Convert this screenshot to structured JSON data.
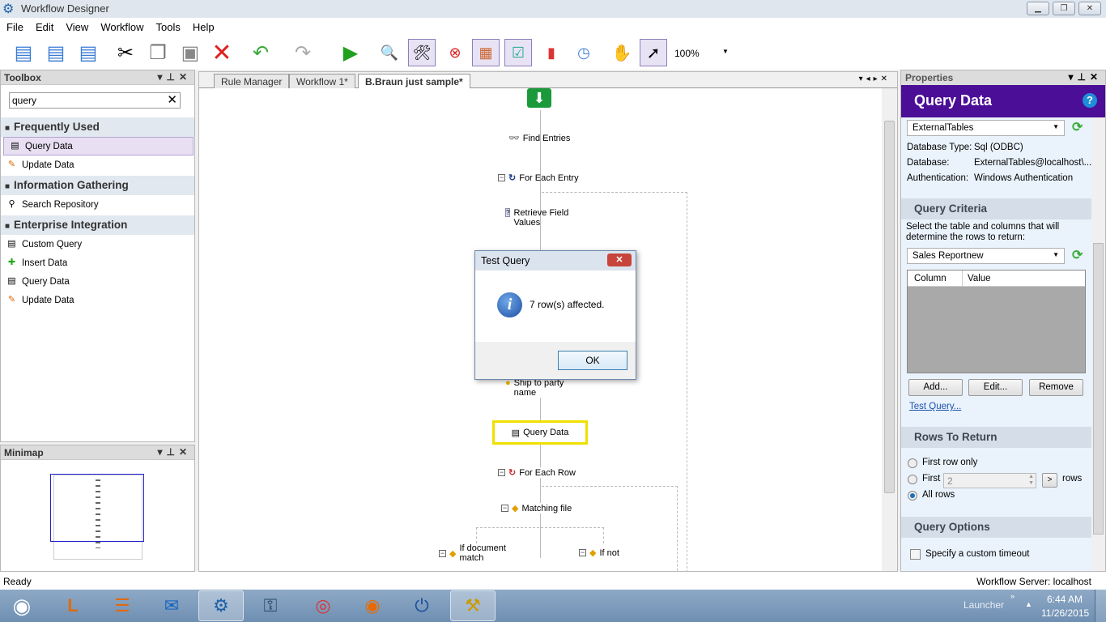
{
  "window": {
    "title": "Workflow Designer",
    "minimize": "▁",
    "restore": "❐",
    "close": "✕"
  },
  "menu": [
    "File",
    "Edit",
    "View",
    "Workflow",
    "Tools",
    "Help"
  ],
  "toolbar": {
    "zoom": "100%"
  },
  "toolbox": {
    "title": "Toolbox",
    "search_value": "query",
    "categories": [
      {
        "label": "Frequently Used",
        "items": [
          "Query Data",
          "Update Data"
        ]
      },
      {
        "label": "Information Gathering",
        "items": [
          "Search Repository"
        ]
      },
      {
        "label": "Enterprise Integration",
        "items": [
          "Custom Query",
          "Insert Data",
          "Query Data",
          "Update Data"
        ]
      }
    ]
  },
  "minimap": {
    "title": "Minimap"
  },
  "tabs": [
    "Rule Manager",
    "Workflow 1*",
    "B.Braun just sample*"
  ],
  "workflow": {
    "nodes": [
      "Find Entries",
      "For Each Entry",
      "Retrieve Field Values",
      "Ship to party name",
      "Query Data",
      "For Each Row",
      "Matching file",
      "If document match",
      "If not"
    ]
  },
  "dialog": {
    "title": "Test Query",
    "message": "7 row(s) affected.",
    "ok": "OK",
    "icon": "i"
  },
  "properties": {
    "title": "Properties",
    "activity": "Query Data",
    "help": "?",
    "connection": "ExternalTables",
    "fields": [
      {
        "label": "Database Type:",
        "value": "Sql (ODBC)"
      },
      {
        "label": "Database:",
        "value": "ExternalTables@localhost\\..."
      },
      {
        "label": "Authentication:",
        "value": "Windows Authentication"
      }
    ],
    "query_criteria": {
      "title": "Query Criteria",
      "description": "Select the table and columns that will determine the rows to return:",
      "table": "Sales Reportnew",
      "columns": [
        "Column",
        "Value"
      ],
      "add": "Add...",
      "edit": "Edit...",
      "remove": "Remove",
      "test_query": "Test Query..."
    },
    "rows_to_return": {
      "title": "Rows To Return",
      "first_row_only": "First row only",
      "first": "First",
      "first_value": "2",
      "token": ">",
      "rows": "rows",
      "all_rows": "All rows",
      "selected": "All rows"
    },
    "query_options": {
      "title": "Query Options",
      "custom_timeout": "Specify a custom timeout",
      "custom_timeout_checked": false
    }
  },
  "status": {
    "left": "Ready",
    "right": "Workflow Server: localhost"
  },
  "taskbar": {
    "launcher": "Launcher",
    "time": "6:44 AM",
    "date": "11/26/2015"
  }
}
